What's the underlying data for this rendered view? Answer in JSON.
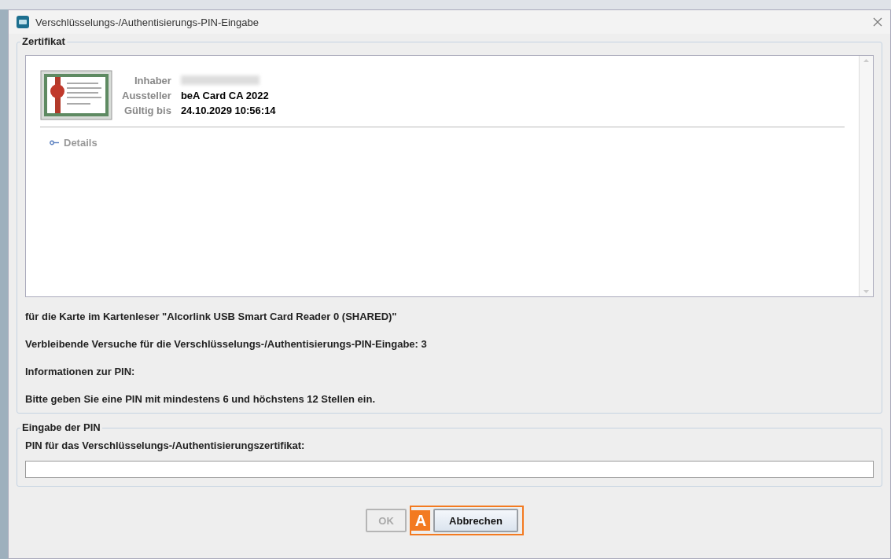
{
  "window": {
    "title": "Verschlüsselungs-/Authentisierungs-PIN-Eingabe"
  },
  "certificate_group": {
    "legend": "Zertifikat",
    "fields": [
      {
        "label": "Inhaber",
        "kind": "redacted"
      },
      {
        "label": "Aussteller",
        "kind": "text",
        "value": "beA Card CA 2022"
      },
      {
        "label": "Gültig bis",
        "kind": "text",
        "value": "24.10.2029 10:56:14"
      }
    ],
    "details_link": "Details",
    "info_lines": [
      "für die Karte im Kartenleser \"Alcorlink USB Smart Card Reader 0 (SHARED)\"",
      "Verbleibende Versuche für die Verschlüsselungs-/Authentisierungs-PIN-Eingabe: 3",
      "Informationen zur PIN:",
      "Bitte geben Sie eine PIN mit mindestens 6 und höchstens 12 Stellen ein."
    ]
  },
  "pin_group": {
    "legend": "Eingabe der PIN",
    "label": "PIN für das Verschlüsselungs-/Authentisierungszertifikat:"
  },
  "buttons": [
    {
      "label": "OK",
      "disabled": true
    },
    {
      "label": "Abbrechen",
      "disabled": false
    }
  ],
  "annotation": {
    "label": "A"
  }
}
